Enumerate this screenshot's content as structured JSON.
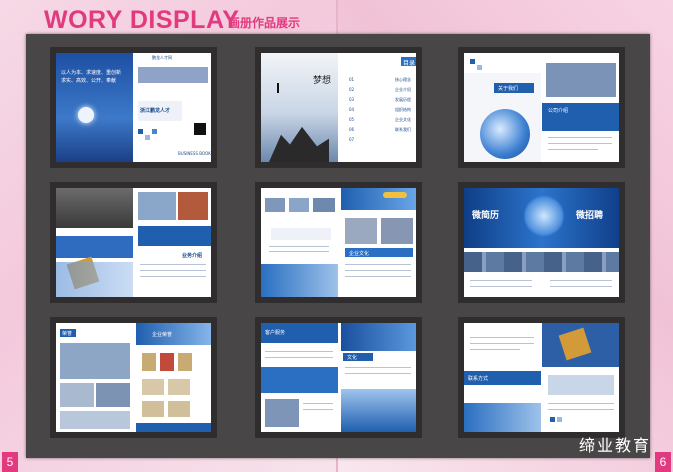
{
  "header": {
    "title": "WORY DISPLAY",
    "subtitle": "画册作品展示"
  },
  "thumbnails": [
    {
      "id": "cover",
      "texts": [
        "以人为本、求速度、重创新",
        "求实、高效、公开、奉献",
        "浙江鹏龙人才",
        "BUSINESS BOOK",
        "鹏龙人才网"
      ]
    },
    {
      "id": "toc",
      "texts": [
        "目录",
        "01",
        "02",
        "03",
        "04",
        "05",
        "06",
        "07",
        "梦想",
        "核心理念",
        "企业介绍",
        "发展历程",
        "组织结构",
        "企业文化",
        "联系我们"
      ]
    },
    {
      "id": "about",
      "texts": [
        "关于我们",
        "公司介绍"
      ]
    },
    {
      "id": "crowd",
      "texts": [
        "业务介绍"
      ]
    },
    {
      "id": "network",
      "texts": [
        "企业文化"
      ]
    },
    {
      "id": "recruit",
      "texts": [
        "微招聘",
        "微简历"
      ]
    },
    {
      "id": "honor",
      "texts": [
        "荣誉",
        "企业荣誉"
      ]
    },
    {
      "id": "service",
      "texts": [
        "客户服务",
        "文化"
      ]
    },
    {
      "id": "contact",
      "texts": [
        "联系方式"
      ]
    }
  ],
  "watermark": "缔业教育",
  "page_numbers": {
    "left": "5",
    "right": "6"
  },
  "colors": {
    "accent": "#e23a7e",
    "board": "#484646",
    "brand_blue": "#1f5fae"
  }
}
